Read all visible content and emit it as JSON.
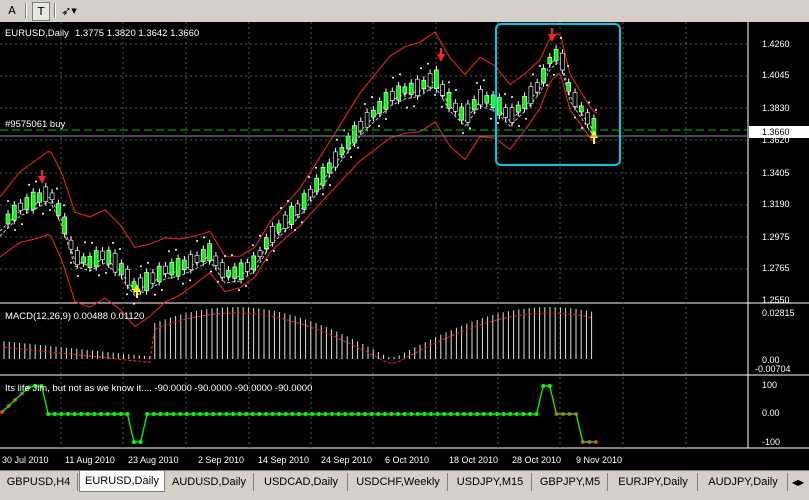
{
  "toolbar": {
    "btn_a": "A",
    "btn_t": "T",
    "btn_arrows": "⇲"
  },
  "chart": {
    "symbol_title": "EURUSD,Daily",
    "ohlc": "1.3775 1.3820 1.3642 1.3660",
    "order_label": "#9575061 buy",
    "macd_label": "MACD(12,26,9) 0.00488 0.01120",
    "indicator_label": "Its life Jim, but not as we know it.... -90.0000 -90.0000 -90.0000 -90.0000",
    "price_axis": [
      "1.4260",
      "1.4045",
      "1.3830",
      "1.3620",
      "1.3405",
      "1.3190",
      "1.2975",
      "1.2765",
      "1.2550"
    ],
    "current_price": "1.3660",
    "macd_axis": [
      "0.02815",
      "0.00",
      "-0.00704"
    ],
    "ind_axis": [
      "100",
      "0.00",
      "-100"
    ],
    "dates": [
      "30 Jul 2010",
      "11 Aug 2010",
      "23 Aug 2010",
      "2 Sep 2010",
      "14 Sep 2010",
      "24 Sep 2010",
      "6 Oct 2010",
      "18 Oct 2010",
      "28 Oct 2010",
      "9 Nov 2010"
    ],
    "colors": {
      "bull": "#ffffff",
      "bear": "#00ff00",
      "bands": "#ff0000",
      "highlight": "#00c8e6",
      "grid": "#5a5a5a"
    }
  },
  "tabs": [
    {
      "label": "GBPUSD,H4"
    },
    {
      "label": "EURUSD,Daily"
    },
    {
      "label": "AUDUSD,Daily"
    },
    {
      "label": "USDCAD,Daily"
    },
    {
      "label": "USDCHF,Weekly"
    },
    {
      "label": "USDJPY,M15"
    },
    {
      "label": "GBPJPY,M5"
    },
    {
      "label": "EURJPY,Daily"
    },
    {
      "label": "AUDJPY,Daily"
    }
  ]
}
